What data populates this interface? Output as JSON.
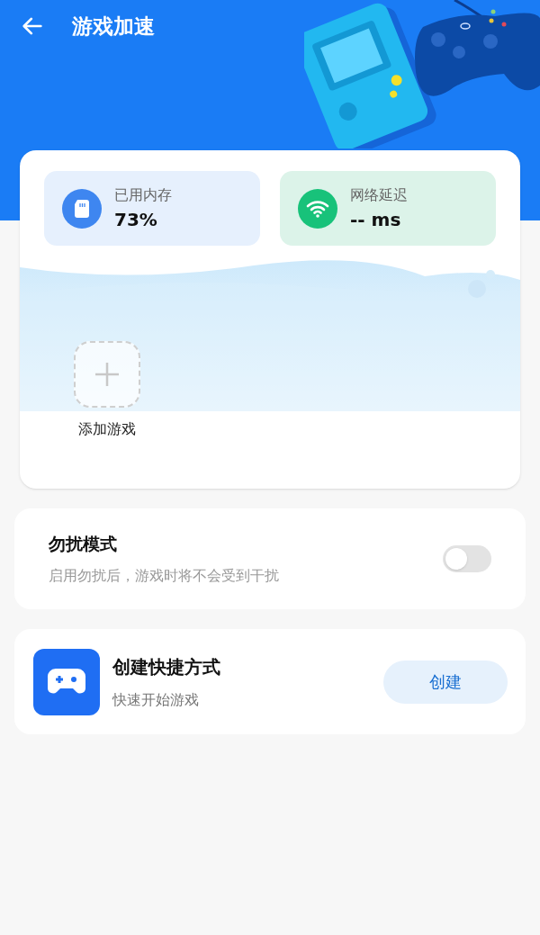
{
  "header": {
    "title": "游戏加速"
  },
  "stats": [
    {
      "kind": "memory",
      "label": "已用内存",
      "value": "73%"
    },
    {
      "kind": "network",
      "label": "网络延迟",
      "value": "-- ms"
    }
  ],
  "add_game": {
    "label": "添加游戏"
  },
  "dnd": {
    "title": "勿扰模式",
    "subtitle": "启用勿扰后，游戏时将不会受到干扰",
    "on": false
  },
  "shortcut": {
    "title": "创建快捷方式",
    "subtitle": "快速开始游戏",
    "button": "创建"
  }
}
